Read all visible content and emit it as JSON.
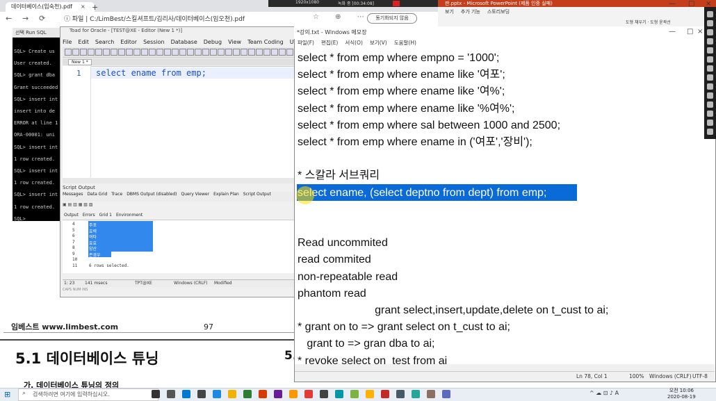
{
  "browser": {
    "tab_label": "데이터베이스(입숙천).pdf",
    "tab_close": "×",
    "new_tab": "+",
    "back": "←",
    "forward": "→",
    "reload": "⟳",
    "url": "ⓘ 파일 | C:/LimBest/스킬셔프트/김리사/데이터베이스(임오천).pdf",
    "sync_button": "동기화되지 않음",
    "toolbar_icons": "☆ ⊕ ⋯"
  },
  "pdf": {
    "footer_left": "임베스트 www.limbest.com",
    "page_number": "97",
    "heading": "5.1 데이터베이스 튜닝",
    "heading_right": "5.",
    "subheading": "가. 데이터베이스 튜닝의 정의"
  },
  "console": {
    "title": "선택 Run SQL",
    "lines": [
      "SQL> Create us",
      "User created.",
      "SQL> grant dba",
      "Grant succeeded",
      "SQL> insert int",
      "insert into de",
      "ERROR at line 1",
      "ORA-00001: uni",
      "SQL> insert int",
      "1 row created.",
      "SQL> insert int",
      "1 row created.",
      "SQL> insert int",
      "1 row created.",
      "SQL>"
    ]
  },
  "toad": {
    "title": "Toad for Oracle - [TEST@XE - Editor (New 1 *)]",
    "menu": [
      "File",
      "Edit",
      "Search",
      "Editor",
      "Session",
      "Database",
      "Debug",
      "View",
      "Team Coding",
      "Utilities",
      "Rerun"
    ],
    "editor_tab": "New 1 *",
    "line_number": "1",
    "code": "select ename from emp;",
    "output_label": "Script Output",
    "output_tabs": [
      "Messages",
      "Data Grid",
      "Trace",
      "DBMS Output (disabled)",
      "Query Viewer",
      "Explain Plan",
      "Script Output"
    ],
    "output_subtabs": [
      "Output",
      "Errors",
      "Grid 1",
      "Environment"
    ],
    "output_rows": [
      {
        "n": "4",
        "t": "주포"
      },
      {
        "n": "5",
        "t": "효력"
      },
      {
        "n": "6",
        "t": "여타"
      },
      {
        "n": "7",
        "t": "효효"
      },
      {
        "n": "8",
        "t": "양산"
      },
      {
        "n": "9",
        "t": "존경우"
      },
      {
        "n": "10",
        "t": ""
      },
      {
        "n": "11",
        "t": "6 rows selected."
      }
    ],
    "status": [
      "1: 23",
      "141 msecs",
      "TPT@XE",
      "Windows (CRLF)",
      "Modified"
    ],
    "status2": "CAPS NUM INS"
  },
  "ppt": {
    "title": "판.pptx - Microsoft PowerPoint (제품 인증 실패)",
    "tabs": [
      "보기",
      "추가 기능",
      "스토리보딩"
    ],
    "ribbon_extra": "도형 채우기 · 도형 윤곽선",
    "min": "—",
    "max": "□",
    "close": "×"
  },
  "recording": {
    "resolution": "1920x1080",
    "rec_label": "녹화 중 [00:34:08]"
  },
  "notepad": {
    "title": "*강의.txt - Windows 메모장",
    "menu": [
      "파일(F)",
      "편집(E)",
      "서식(O)",
      "보기(V)",
      "도움말(H)"
    ],
    "lines": [
      "select * from emp where empno = '1000';",
      "select * from emp where ename like '여포';",
      "select * from emp where ename like '여%';",
      "select * from emp where ename like '%여%';",
      "select * from emp where sal between 1000 and 2500;",
      "select * from emp where ename in ('여포','장비');",
      "",
      "* 스칼라 서브쿼리",
      "select ename, (select deptno from dept) from emp;",
      "",
      "",
      "Read uncommited",
      "read commited",
      "non-repeatable read",
      "phantom read",
      "                         grant select,insert,update,delete on t_cust to ai;",
      "* grant on to => grant select on t_cust to ai;",
      "   grant to => gran dba to ai;",
      "* revoke select on  test from ai"
    ],
    "status": {
      "position": "Ln 78, Col 1",
      "zoom": "100%",
      "eol": "Windows (CRLF)",
      "encoding": "UTF-8"
    },
    "min": "—",
    "max": "□",
    "close": "×"
  },
  "taskbar": {
    "start_icon": "⊞",
    "search_placeholder": "검색하려면 여기에 입력하십시오.",
    "search_icon": "⌕",
    "time": "오전 10:06",
    "date": "2020-08-19",
    "tray_text": "^ ☁ ⊡ ♪ A"
  }
}
